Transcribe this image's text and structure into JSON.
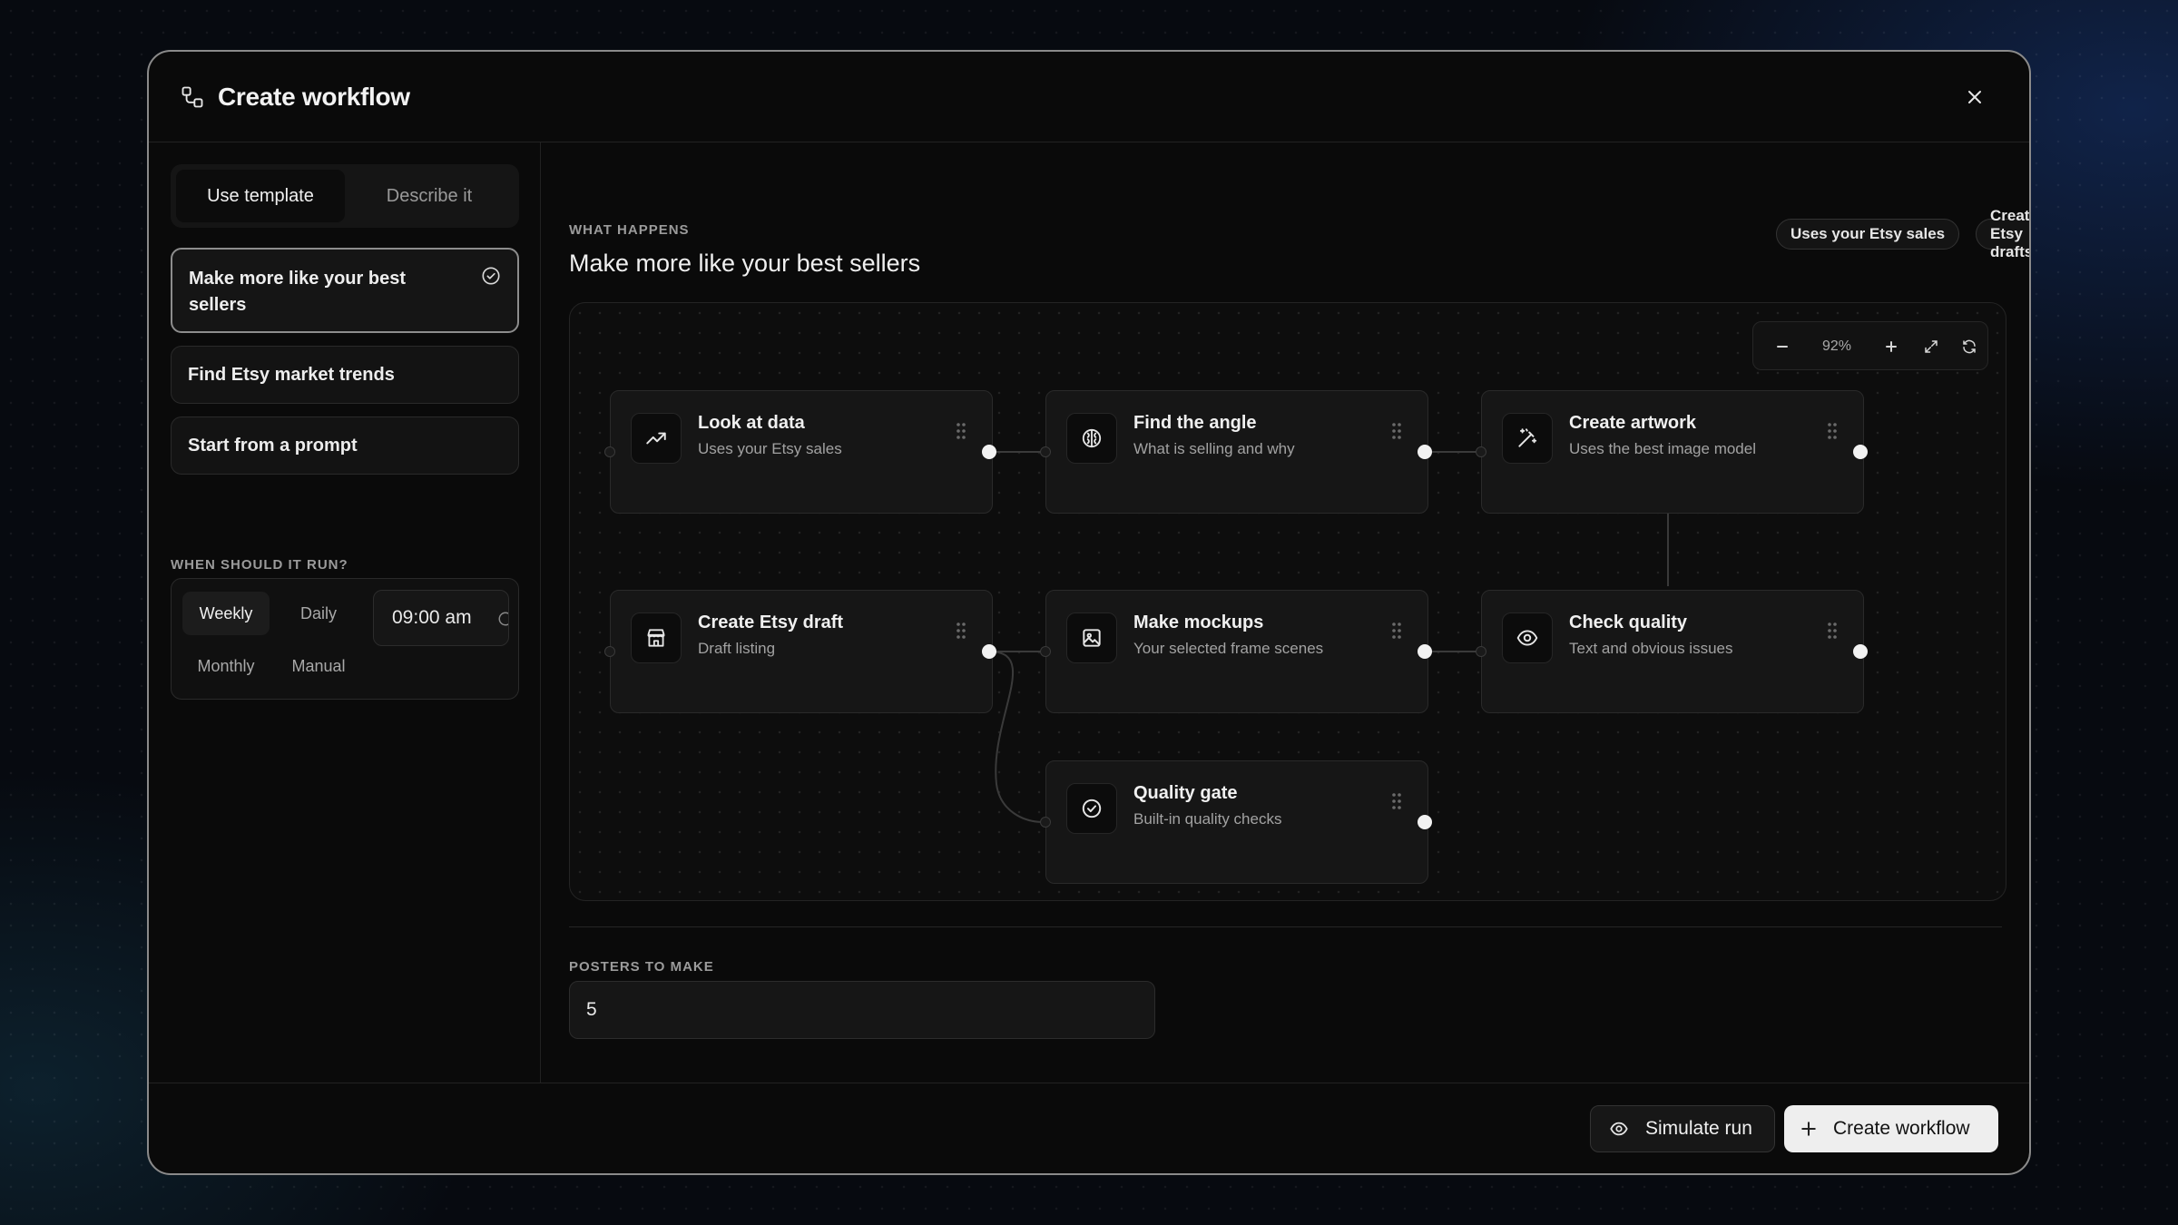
{
  "header": {
    "title": "Create workflow",
    "title_icon": "workflow-icon",
    "close_icon": "close-icon"
  },
  "sidebar": {
    "tabs": [
      {
        "label": "Use template",
        "active": true
      },
      {
        "label": "Describe it",
        "active": false
      }
    ],
    "templates": [
      {
        "label": "Make more like your best sellers",
        "selected": true
      },
      {
        "label": "Find Etsy market trends",
        "selected": false
      },
      {
        "label": "Start from a prompt",
        "selected": false
      }
    ],
    "schedule": {
      "label": "When should it run?",
      "options": [
        {
          "label": "Weekly",
          "active": true
        },
        {
          "label": "Daily",
          "active": false
        },
        {
          "label": "Monthly",
          "active": false
        },
        {
          "label": "Manual",
          "active": false
        }
      ],
      "time": "09:00 am"
    }
  },
  "main": {
    "section_label": "What happens",
    "title": "Make more like your best sellers",
    "pills": [
      "Uses your Etsy sales",
      "Creates Etsy drafts"
    ],
    "zoom": {
      "level": "92%"
    },
    "nodes": [
      {
        "title": "Look at data",
        "subtitle": "Uses your Etsy sales",
        "icon": "trending-up-icon"
      },
      {
        "title": "Find the angle",
        "subtitle": "What is selling and why",
        "icon": "brain-icon"
      },
      {
        "title": "Create artwork",
        "subtitle": "Uses the best image model",
        "icon": "magic-wand-icon"
      },
      {
        "title": "Create Etsy draft",
        "subtitle": "Draft listing",
        "icon": "store-icon"
      },
      {
        "title": "Make mockups",
        "subtitle": "Your selected frame scenes",
        "icon": "image-icon"
      },
      {
        "title": "Check quality",
        "subtitle": "Text and obvious issues",
        "icon": "eye-icon"
      },
      {
        "title": "Quality gate",
        "subtitle": "Built-in quality checks",
        "icon": "check-circle-icon"
      }
    ],
    "posters": {
      "label": "Posters to make",
      "value": "5"
    }
  },
  "footer": {
    "simulate_label": "Simulate run",
    "create_label": "Create workflow"
  }
}
